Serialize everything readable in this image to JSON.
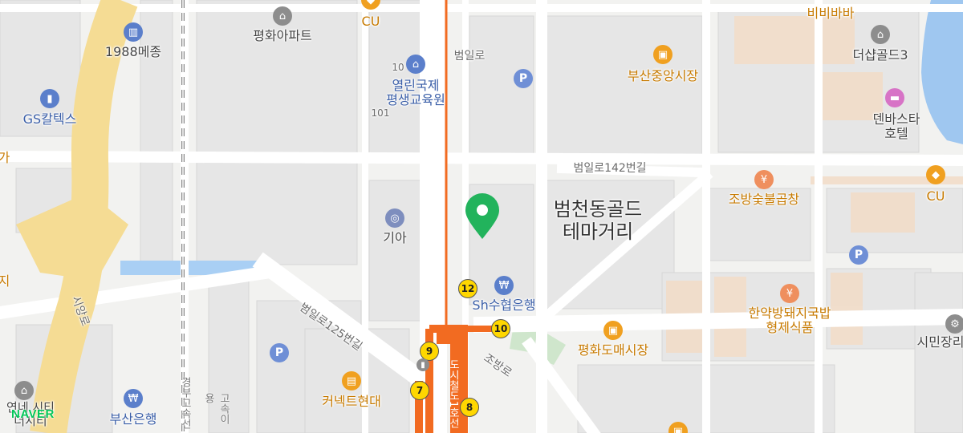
{
  "brand": "NAVER",
  "colors": {
    "background": "#f2f2f0",
    "block": "#e6e6e6",
    "road": "#ffffff",
    "highway": "#f5dc94",
    "subway": "#f26b21",
    "water": "#9fc7f0",
    "park": "#cfe6cc",
    "pin": "#22b35c"
  },
  "district": {
    "name": "범천동골드\n테마거리",
    "line1": "범천동골드",
    "line2": "테마거리"
  },
  "roads": {
    "beomil": "범일로",
    "beomil142": "범일로142번길",
    "beomil125": "범일로125번길",
    "jobang": "조방로",
    "siyam": "시앙로",
    "subway_line": "도시철도1호선",
    "rail_line": "경부고속선",
    "rail_line2": "고속이용"
  },
  "places": {
    "cu_top": "CU",
    "bibibaba": "비비바바",
    "pyeonghwa_apt": "평화아파트",
    "meijong": "1988메종",
    "yeollin_1": "열린국제",
    "yeollin_2": "평생교육원",
    "market_central": "부산중앙시장",
    "deshop": "더샵골드3",
    "denbasta_1": "덴바스타",
    "denbasta_2": "호텔",
    "gs": "GS칼텍스",
    "num_101a": "10",
    "num_101b": "101",
    "kia": "기아",
    "jobang_gopchang": "조방숯불곱창",
    "cu_right": "CU",
    "sh_bank": "Sh수협은행",
    "hanyak_1": "한약방돼지국밥",
    "hanyak_2": "형제식품",
    "pyeonghwa_market": "평화도매시장",
    "simin": "시민장리",
    "connect": "커넥트현대",
    "busan_bank": "부산은행",
    "left_ga": "가",
    "left_ji": "지",
    "city_1": "연네 시티",
    "city_2": "더시티"
  },
  "exits": [
    "12",
    "10",
    "9",
    "7",
    "8"
  ]
}
